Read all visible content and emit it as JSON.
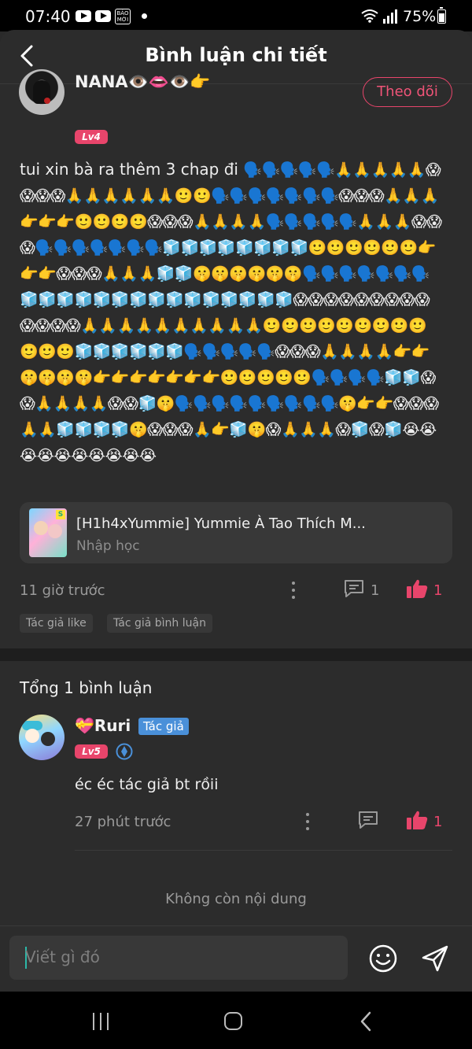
{
  "status_bar": {
    "time": "07:40",
    "battery": "75%",
    "news_icon_text": "BÁO\nMỚI"
  },
  "header": {
    "title": "Bình luận chi tiết"
  },
  "comment": {
    "author": "NANA👁️👄👁️👉",
    "level": "Lv4",
    "follow_label": "Theo dõi",
    "text": "tui xin bà ra thêm 3 chap đi",
    "emojis": "🗣️🗣️🗣️🗣️🗣️🙏🙏🙏🙏🙏😱😱😱😱🙏🙏🙏🙏🙏🙏🙂🙂🗣️🗣️🗣️🗣️🗣️🗣️🗣️😱😱😱🙏🙏🙏👉👉👉🙂🙂🙂🙂😱😱😱🙏🙏🙏🙏🗣️🗣️🗣️🗣️🗣️🙏🙏🙏😱😱😱🗣️🗣️🗣️🗣️🗣️🗣️🗣️🧊🧊🧊🧊🧊🧊🧊🧊🙂🙂🙂🙂🙂🙂👉👉👉😱😱😱🙏🙏🙏🧊🧊🤫🤫🤫🤫🤫🤫🗣️🗣️🗣️🗣️🗣️🗣️🗣️🧊🧊🧊🧊🧊🧊🧊🧊🧊🧊🧊🧊🧊🧊🧊😱😱😱😱😱😱😱😱😱😱😱😱😱🙏🙏🙏🙏🙏🙏🙏🙏🙏🙏🙂🙂🙂🙂🙂🙂🙂🙂🙂🙂🙂🙂🧊🧊🧊🧊🧊🧊🗣️🗣️🗣️🗣️🗣️😱😱😱🙏🙏🙏🙏👉👉🤫🤫🤫🤫👉👉👉👉👉👉👉🙂🙂🙂🙂🙂🗣️🗣️🗣️🗣️🧊🧊😱😱🙏🙏🙏🙏😱😱🧊🤫🗣️🗣️🗣️🗣️🗣️🗣️🗣️🗣️🗣️🤫👉👉😱😱😱🙏🙏🧊🧊🧊🧊🤫😱😱😱🙏👉🧊🤫😱🙏🙏🙏😱🧊😱🧊😭😭😭😭😭😭😭😭😭😭",
    "manga": {
      "title": "[H1h4xYummie] Yummie À Tao Thích M...",
      "subtitle": "Nhập học"
    },
    "time": "11 giờ trước",
    "comment_count": "1",
    "like_count": "1",
    "tags": [
      "Tác giả like",
      "Tác giả bình luận"
    ]
  },
  "replies": {
    "total_label": "Tổng 1 bình luận",
    "items": [
      {
        "author": "💝Ruri",
        "author_tag": "Tác giả",
        "level": "Lv5",
        "text": "éc éc tác giả bt rồii",
        "time": "27 phút trước",
        "comment_count": "",
        "like_count": "1"
      }
    ],
    "end_label": "Không còn nội dung"
  },
  "composer": {
    "placeholder": "Viết gì đó"
  },
  "colors": {
    "accent": "#e8456b",
    "background": "#2c2c2c",
    "author_tag": "#4a90d9"
  }
}
